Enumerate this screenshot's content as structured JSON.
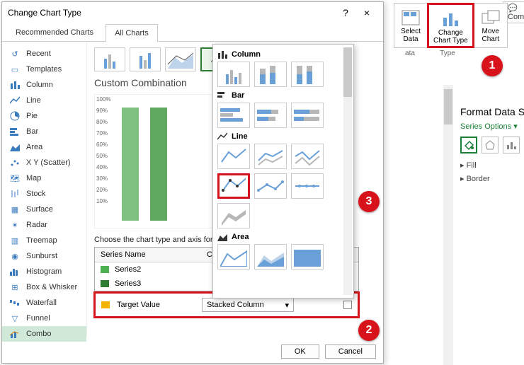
{
  "dialog": {
    "title": "Change Chart Type",
    "help": "?",
    "close": "×",
    "tabs": {
      "recommended": "Recommended Charts",
      "all": "All Charts"
    },
    "nav": {
      "recent": "Recent",
      "templates": "Templates",
      "column": "Column",
      "line": "Line",
      "pie": "Pie",
      "bar": "Bar",
      "area": "Area",
      "scatter": "X Y (Scatter)",
      "map": "Map",
      "stock": "Stock",
      "surface": "Surface",
      "radar": "Radar",
      "treemap": "Treemap",
      "sunburst": "Sunburst",
      "histogram": "Histogram",
      "boxwhisker": "Box & Whisker",
      "waterfall": "Waterfall",
      "funnel": "Funnel",
      "combo": "Combo"
    },
    "custom_title": "Custom Combination",
    "preview_ticks": [
      "100%",
      "90%",
      "80%",
      "70%",
      "60%",
      "50%",
      "40%",
      "30%",
      "20%",
      "10%"
    ],
    "series_head": "Choose the chart type and axis for y",
    "series_cols": {
      "name": "Series Name",
      "chart": "Cha"
    },
    "series": {
      "s2": "Series2",
      "s3": "Series3",
      "target": "Target Value"
    },
    "target_type": "Stacked Column",
    "buttons": {
      "ok": "OK",
      "cancel": "Cancel"
    }
  },
  "picker": {
    "column": "Column",
    "bar": "Bar",
    "line": "Line",
    "area": "Area"
  },
  "ribbon": {
    "select": "Select\nData",
    "change": "Change\nChart Type",
    "move": "Move\nChart",
    "grp_data": "ata",
    "grp_type": "Type",
    "com": "Com"
  },
  "format": {
    "title": "Format Data S",
    "series_options": "Series Options",
    "fill": "Fill",
    "border": "Border"
  },
  "steps": {
    "s1": "1",
    "s2": "2",
    "s3": "3"
  }
}
